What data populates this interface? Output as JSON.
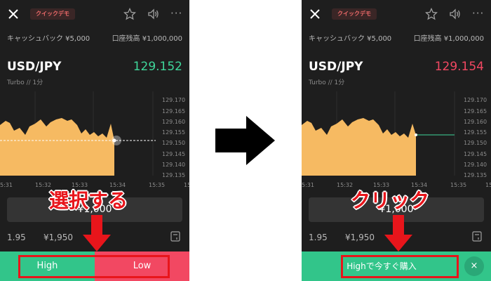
{
  "colors": {
    "background": "#1e1e1e",
    "price_up": "#3fd69a",
    "price_down": "#f24862",
    "high": "#32c58a",
    "low": "#f24862",
    "chart_fill": "#f6ba62",
    "annotation": "#e8151b"
  },
  "left": {
    "demo_badge": "クイックデモ",
    "cashback_label": "キャッシュバック ¥5,000",
    "balance_label": "口座残高 ¥1,000,000",
    "pair": "USD/JPY",
    "price": "129.152",
    "subline": "Turbo // 1分",
    "price_ticks": [
      "129.170",
      "129.165",
      "129.160",
      "129.155",
      "129.150",
      "129.145",
      "129.140",
      "129.135"
    ],
    "time_ticks": [
      "5:31",
      "15:32",
      "15:33",
      "15:34",
      "15:35",
      "15"
    ],
    "amount": "¥1,000",
    "payout_rate": "1.95",
    "payout_amount": "¥1,950",
    "high_label": "High",
    "low_label": "Low",
    "annotation": "選択する"
  },
  "right": {
    "demo_badge": "クイックデモ",
    "cashback_label": "キャッシュバック ¥5,000",
    "balance_label": "口座残高 ¥1,000,000",
    "pair": "USD/JPY",
    "price": "129.154",
    "subline": "Turbo // 1分",
    "price_ticks": [
      "129.170",
      "129.165",
      "129.160",
      "129.155",
      "129.150",
      "129.145",
      "129.140",
      "129.135"
    ],
    "time_ticks": [
      "5:31",
      "15:32",
      "15:33",
      "15:34",
      "15:35",
      "15"
    ],
    "amount": "¥1,000",
    "payout_rate": "1.95",
    "payout_amount": "¥1,950",
    "buy_label": "Highで今すぐ購入",
    "close_label": "×",
    "annotation": "クリック"
  },
  "icons": [
    "close-icon",
    "star-icon",
    "speaker-icon",
    "more-icon",
    "calculator-icon",
    "down-arrow-icon",
    "right-arrow-icon"
  ]
}
